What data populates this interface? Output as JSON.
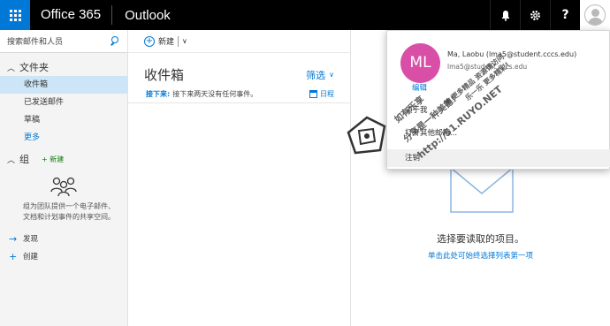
{
  "header": {
    "brand": "Office 365",
    "app": "Outlook",
    "icons": [
      "waffle-icon",
      "bell-icon",
      "gear-icon",
      "help-icon",
      "avatar"
    ]
  },
  "search": {
    "placeholder": "搜索邮件和人员"
  },
  "sidebar": {
    "folders_title": "文件夹",
    "folders": [
      {
        "label": "收件箱",
        "selected": true
      },
      {
        "label": "已发送邮件",
        "selected": false
      },
      {
        "label": "草稿",
        "selected": false
      }
    ],
    "more": "更多",
    "groups_title": "组",
    "groups_new": "新建",
    "groups_desc": "组为团队提供一个电子邮件、文档和计划事件的共享空间。",
    "actions": [
      {
        "glyph": "→",
        "label": "发现"
      },
      {
        "glyph": "+",
        "label": "创建"
      }
    ]
  },
  "toolbar": {
    "new_label": "新建"
  },
  "message_list": {
    "title": "收件箱",
    "filter": "筛选",
    "next_label": "接下来:",
    "next_text": "接下来两天没有任何事件。",
    "calendar_label": "日程"
  },
  "reading_pane": {
    "title": "选择要读取的项目。",
    "link": "单击此处可始终选择列表第一项"
  },
  "account_popup": {
    "initials": "ML",
    "name": "Ma, Laobu (lma5@student.cccs.edu)",
    "email": "lma5@student.cccs.edu",
    "edit_link": "编辑",
    "about_me": "关于我",
    "open_other": "打开其他邮箱...",
    "sign_out": "注销"
  },
  "watermark": {
    "line1": "如有乐享",
    "line2": "分享是一种美德!",
    "line3": "http://51.RUYO.NET",
    "line4": "美 更多精品 资源请访问",
    "line5": "乐一乐 更多精彩!"
  },
  "colors": {
    "accent": "#0078d7",
    "topbar": "#000000",
    "avatar": "#d94fa8",
    "selected": "#cde6f7",
    "group_new": "#107c10"
  }
}
